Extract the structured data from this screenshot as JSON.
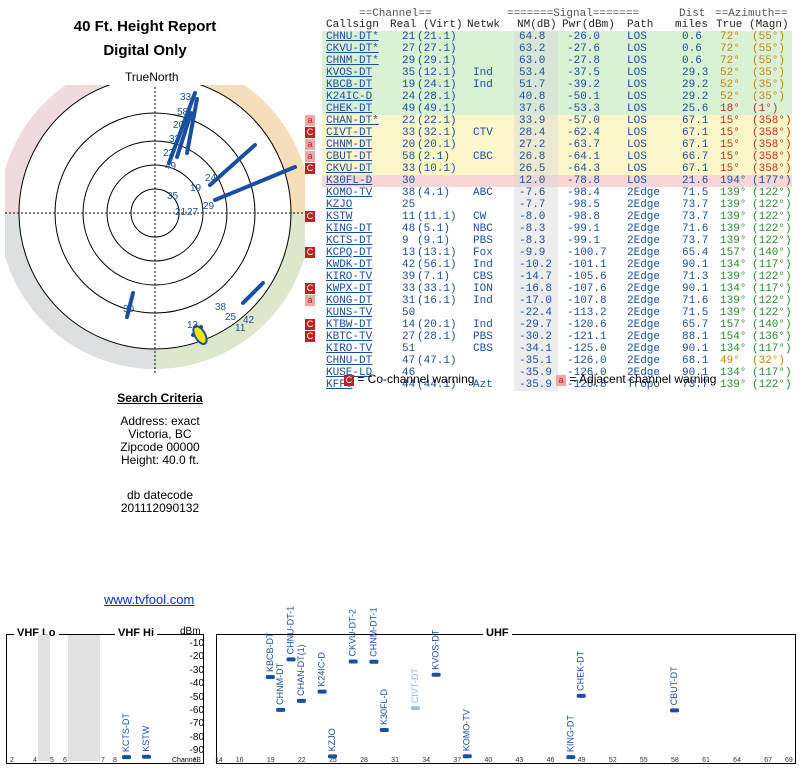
{
  "report": {
    "title": "40 Ft. Height Report",
    "subtitle": "Digital Only",
    "true_north": "TrueNorth"
  },
  "criteria": {
    "heading": "Search Criteria",
    "address": "Address: exact",
    "city": "Victoria, BC",
    "zip": "Zipcode 00000",
    "height": "Height: 40.0 ft.",
    "db_label": "db datecode",
    "db_value": "201112090132"
  },
  "link": "www.tvfool.com",
  "table_headers": {
    "channel_group": "==Channel==",
    "signal_group": "=======Signal=======",
    "dist_top": "Dist",
    "azimuth_group": "==Azimuth==",
    "callsign": "Callsign",
    "real_virt": "Real (Virt)",
    "netwk": "Netwk",
    "nm": "NM(dB)",
    "pwr": "Pwr(dBm)",
    "path": "Path",
    "miles": "miles",
    "true_magn": "True (Magn)"
  },
  "stations": [
    {
      "callsign": "CHNU-DT*",
      "real": "21",
      "virt": "(21.1)",
      "netwk": "",
      "nm": "64.8",
      "pwr": "-26.0",
      "path": "LOS",
      "miles": "0.6",
      "az": "72°",
      "mag": "(55°)",
      "band": "green",
      "warn": ""
    },
    {
      "callsign": "CKVU-DT*",
      "real": "27",
      "virt": "(27.1)",
      "netwk": "",
      "nm": "63.2",
      "pwr": "-27.6",
      "path": "LOS",
      "miles": "0.6",
      "az": "72°",
      "mag": "(55°)",
      "band": "green",
      "warn": ""
    },
    {
      "callsign": "CHNM-DT*",
      "real": "29",
      "virt": "(29.1)",
      "netwk": "",
      "nm": "63.0",
      "pwr": "-27.8",
      "path": "LOS",
      "miles": "0.6",
      "az": "72°",
      "mag": "(55°)",
      "band": "green",
      "warn": ""
    },
    {
      "callsign": "KVOS-DT",
      "real": "35",
      "virt": "(12.1)",
      "netwk": "Ind",
      "nm": "53.4",
      "pwr": "-37.5",
      "path": "LOS",
      "miles": "29.3",
      "az": "52°",
      "mag": "(35°)",
      "band": "green",
      "warn": ""
    },
    {
      "callsign": "KBCB-DT",
      "real": "19",
      "virt": "(24.1)",
      "netwk": "Ind",
      "nm": "51.7",
      "pwr": "-39.2",
      "path": "LOS",
      "miles": "29.2",
      "az": "52°",
      "mag": "(35°)",
      "band": "green",
      "warn": ""
    },
    {
      "callsign": "K24IC-D",
      "real": "24",
      "virt": "(28.1)",
      "netwk": "",
      "nm": "40.8",
      "pwr": "-50.1",
      "path": "LOS",
      "miles": "29.2",
      "az": "52°",
      "mag": "(35°)",
      "band": "green",
      "warn": ""
    },
    {
      "callsign": "CHEK-DT",
      "real": "49",
      "virt": "(49.1)",
      "netwk": "",
      "nm": "37.6",
      "pwr": "-53.3",
      "path": "LOS",
      "miles": "25.6",
      "az": "18°",
      "mag": "(1°)",
      "band": "green",
      "warn": ""
    },
    {
      "callsign": "CHAN-DT*",
      "real": "22",
      "virt": "(22.1)",
      "netwk": "",
      "nm": "33.9",
      "pwr": "-57.0",
      "path": "LOS",
      "miles": "67.1",
      "az": "15°",
      "mag": "(358°)",
      "band": "yellow",
      "warn": "a"
    },
    {
      "callsign": "CIVT-DT",
      "real": "33",
      "virt": "(32.1)",
      "netwk": "CTV",
      "nm": "28.4",
      "pwr": "-62.4",
      "path": "LOS",
      "miles": "67.1",
      "az": "15°",
      "mag": "(358°)",
      "band": "yellow",
      "warn": "C"
    },
    {
      "callsign": "CHNM-DT",
      "real": "20",
      "virt": "(20.1)",
      "netwk": "",
      "nm": "27.2",
      "pwr": "-63.7",
      "path": "LOS",
      "miles": "67.1",
      "az": "15°",
      "mag": "(358°)",
      "band": "yellow",
      "warn": "a"
    },
    {
      "callsign": "CBUT-DT",
      "real": "58",
      "virt": "(2.1)",
      "netwk": "CBC",
      "nm": "26.8",
      "pwr": "-64.1",
      "path": "LOS",
      "miles": "66.7",
      "az": "15°",
      "mag": "(358°)",
      "band": "yellow",
      "warn": "a"
    },
    {
      "callsign": "CKVU-DT",
      "real": "33",
      "virt": "(10.1)",
      "netwk": "",
      "nm": "26.5",
      "pwr": "-64.3",
      "path": "LOS",
      "miles": "67.1",
      "az": "15°",
      "mag": "(358°)",
      "band": "yellow",
      "warn": "C"
    },
    {
      "callsign": "K30FL-D",
      "real": "30",
      "virt": "",
      "netwk": "",
      "nm": "12.0",
      "pwr": "-78.8",
      "path": "LOS",
      "miles": "21.6",
      "az": "194°",
      "mag": "(177°)",
      "band": "pink",
      "warn": ""
    },
    {
      "callsign": "KOMO-TV",
      "real": "38",
      "virt": "(4.1)",
      "netwk": "ABC",
      "nm": "-7.6",
      "pwr": "-98.4",
      "path": "2Edge",
      "miles": "71.5",
      "az": "139°",
      "mag": "(122°)",
      "band": "white",
      "warn": ""
    },
    {
      "callsign": "KZJO",
      "real": "25",
      "virt": "",
      "netwk": "",
      "nm": "-7.7",
      "pwr": "-98.5",
      "path": "2Edge",
      "miles": "73.7",
      "az": "139°",
      "mag": "(122°)",
      "band": "white",
      "warn": ""
    },
    {
      "callsign": "KSTW",
      "real": "11",
      "virt": "(11.1)",
      "netwk": "CW",
      "nm": "-8.0",
      "pwr": "-98.8",
      "path": "2Edge",
      "miles": "73.7",
      "az": "139°",
      "mag": "(122°)",
      "band": "white",
      "warn": "C"
    },
    {
      "callsign": "KING-DT",
      "real": "48",
      "virt": "(5.1)",
      "netwk": "NBC",
      "nm": "-8.3",
      "pwr": "-99.1",
      "path": "2Edge",
      "miles": "71.6",
      "az": "139°",
      "mag": "(122°)",
      "band": "white",
      "warn": ""
    },
    {
      "callsign": "KCTS-DT",
      "real": "9",
      "virt": "(9.1)",
      "netwk": "PBS",
      "nm": "-8.3",
      "pwr": "-99.1",
      "path": "2Edge",
      "miles": "73.7",
      "az": "139°",
      "mag": "(122°)",
      "band": "white",
      "warn": ""
    },
    {
      "callsign": "KCPQ-DT",
      "real": "13",
      "virt": "(13.1)",
      "netwk": "Fox",
      "nm": "-9.9",
      "pwr": "-100.7",
      "path": "2Edge",
      "miles": "65.4",
      "az": "157°",
      "mag": "(140°)",
      "band": "white",
      "warn": "C"
    },
    {
      "callsign": "KWDK-DT",
      "real": "42",
      "virt": "(56.1)",
      "netwk": "Ind",
      "nm": "-10.2",
      "pwr": "-101.1",
      "path": "2Edge",
      "miles": "90.1",
      "az": "134°",
      "mag": "(117°)",
      "band": "white",
      "warn": ""
    },
    {
      "callsign": "KIRO-TV",
      "real": "39",
      "virt": "(7.1)",
      "netwk": "CBS",
      "nm": "-14.7",
      "pwr": "-105.6",
      "path": "2Edge",
      "miles": "71.3",
      "az": "139°",
      "mag": "(122°)",
      "band": "white",
      "warn": ""
    },
    {
      "callsign": "KWPX-DT",
      "real": "33",
      "virt": "(33.1)",
      "netwk": "ION",
      "nm": "-16.8",
      "pwr": "-107.6",
      "path": "2Edge",
      "miles": "90.1",
      "az": "134°",
      "mag": "(117°)",
      "band": "white",
      "warn": "C"
    },
    {
      "callsign": "KONG-DT",
      "real": "31",
      "virt": "(16.1)",
      "netwk": "Ind",
      "nm": "-17.0",
      "pwr": "-107.8",
      "path": "2Edge",
      "miles": "71.6",
      "az": "139°",
      "mag": "(122°)",
      "band": "white",
      "warn": "a"
    },
    {
      "callsign": "KUNS-TV",
      "real": "50",
      "virt": "",
      "netwk": "",
      "nm": "-22.4",
      "pwr": "-113.2",
      "path": "2Edge",
      "miles": "71.5",
      "az": "139°",
      "mag": "(122°)",
      "band": "white",
      "warn": ""
    },
    {
      "callsign": "KTBW-DT",
      "real": "14",
      "virt": "(20.1)",
      "netwk": "Ind",
      "nm": "-29.7",
      "pwr": "-120.6",
      "path": "2Edge",
      "miles": "65.7",
      "az": "157°",
      "mag": "(140°)",
      "band": "white",
      "warn": "C"
    },
    {
      "callsign": "KBTC-TV",
      "real": "27",
      "virt": "(28.1)",
      "netwk": "PBS",
      "nm": "-30.2",
      "pwr": "-121.1",
      "path": "2Edge",
      "miles": "88.1",
      "az": "154°",
      "mag": "(136°)",
      "band": "white",
      "warn": "C"
    },
    {
      "callsign": "KIRO-TV",
      "real": "51",
      "virt": "",
      "netwk": "CBS",
      "nm": "-34.1",
      "pwr": "-125.0",
      "path": "2Edge",
      "miles": "90.1",
      "az": "134°",
      "mag": "(117°)",
      "band": "white",
      "warn": ""
    },
    {
      "callsign": "CHNU-DT",
      "real": "47",
      "virt": "(47.1)",
      "netwk": "",
      "nm": "-35.1",
      "pwr": "-126.0",
      "path": "2Edge",
      "miles": "68.1",
      "az": "49°",
      "mag": "(32°)",
      "band": "white",
      "warn": ""
    },
    {
      "callsign": "KUSE-LD",
      "real": "46",
      "virt": "",
      "netwk": "",
      "nm": "-35.9",
      "pwr": "-126.0",
      "path": "2Edge",
      "miles": "90.1",
      "az": "134°",
      "mag": "(117°)",
      "band": "white",
      "warn": ""
    },
    {
      "callsign": "KFFV",
      "real": "44",
      "virt": "(44.1)",
      "netwk": "Azt",
      "nm": "-35.9",
      "pwr": "-126.8",
      "path": "Tropo",
      "miles": "73.7",
      "az": "139°",
      "mag": "(122°)",
      "band": "white",
      "warn": ""
    }
  ],
  "warnings": {
    "cochannel_glyph": "C",
    "cochannel_text": "= Co-channel warning",
    "adjacent_glyph": "a",
    "adjacent_text": "= Adjacent channel warning"
  },
  "colors": {
    "green_band": "#d9f2d4",
    "yellow_band": "#fbf7c9",
    "pink_band": "#f9d7d7",
    "nm_col": "#d6d6d6",
    "link_blue": "#1a4fa0",
    "az_green": "#2a8a2a",
    "az_orange": "#c8820a",
    "az_red": "#c0301a",
    "az_blue": "#1a4fa0"
  },
  "polar": {
    "labels_top": [
      "33",
      "58",
      "20",
      "33",
      "22",
      "49"
    ],
    "labels_center": [
      "24",
      "19",
      "35",
      "29",
      "21",
      "27"
    ],
    "labels_se": [
      "38",
      "25",
      "42",
      "11",
      "13"
    ],
    "label_sw": "30"
  },
  "spectrum": {
    "vhf_lo": "VHF Lo",
    "vhf_hi": "VHF Hi",
    "uhf": "UHF",
    "dbm": "dBm",
    "channel_label": "Channel",
    "y_ticks": [
      "-10",
      "-20",
      "-30",
      "-40",
      "-50",
      "-60",
      "-70",
      "-80",
      "-90"
    ],
    "x_ticks_vhf": [
      "2",
      "4",
      "5",
      "6",
      "7",
      "8",
      "13"
    ],
    "x_ticks_uhf": [
      "14",
      "16",
      "19",
      "22",
      "25",
      "28",
      "31",
      "34",
      "37",
      "40",
      "43",
      "46",
      "49",
      "52",
      "55",
      "58",
      "61",
      "64",
      "67",
      "69"
    ],
    "stations": [
      {
        "label": "KBCB-DT",
        "ch": 19,
        "dbm": -39.2
      },
      {
        "label": "CHNM-DT",
        "ch": 20,
        "dbm": -63.7
      },
      {
        "label": "CHNU-DT-1",
        "ch": 21,
        "dbm": -26.0
      },
      {
        "label": "CHAN-DT(1)",
        "ch": 22,
        "dbm": -57.0
      },
      {
        "label": "K24IC-D",
        "ch": 24,
        "dbm": -50.1
      },
      {
        "label": "KZJO",
        "ch": 25,
        "dbm": -98.5
      },
      {
        "label": "CKVU-DT-2",
        "ch": 27,
        "dbm": -27.6
      },
      {
        "label": "CHNM-DT-1",
        "ch": 29,
        "dbm": -27.8
      },
      {
        "label": "K30FL-D",
        "ch": 30,
        "dbm": -78.8
      },
      {
        "label": "CIVT-DT",
        "ch": 33,
        "dbm": -62.4
      },
      {
        "label": "KVOS-DT",
        "ch": 35,
        "dbm": -37.5
      },
      {
        "label": "KOMO-TV",
        "ch": 38,
        "dbm": -98.4
      },
      {
        "label": "KING-DT",
        "ch": 48,
        "dbm": -99.1
      },
      {
        "label": "CHEK-DT",
        "ch": 49,
        "dbm": -53.3
      },
      {
        "label": "CBUT-DT",
        "ch": 58,
        "dbm": -64.1
      },
      {
        "label": "KCTS-DT",
        "ch": 9,
        "dbm": -99.1
      },
      {
        "label": "KSTW",
        "ch": 11,
        "dbm": -98.8
      }
    ]
  }
}
